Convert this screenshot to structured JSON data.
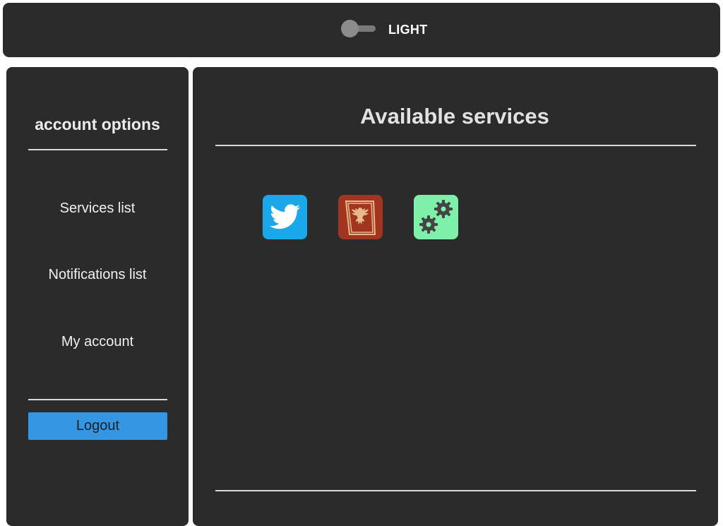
{
  "header": {
    "theme_label": "LIGHT",
    "toggle_icon": "toggle-switch-icon"
  },
  "sidebar": {
    "title": "account options",
    "items": [
      {
        "label": "Services list"
      },
      {
        "label": "Notifications list"
      },
      {
        "label": "My account"
      }
    ],
    "logout_label": "Logout"
  },
  "main": {
    "title": "Available services",
    "services": [
      {
        "icon": "twitter-icon",
        "color": "#1da1f2"
      },
      {
        "icon": "eagle-crest-icon",
        "color": "#a1351f"
      },
      {
        "icon": "gears-icon",
        "color": "#7ef0aa"
      }
    ]
  },
  "colors": {
    "panel_background": "#2b2b2b",
    "logout_button": "#3597e3",
    "divider": "#d9d9d9"
  }
}
